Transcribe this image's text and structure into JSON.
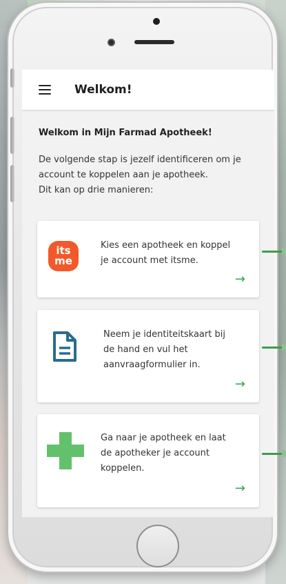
{
  "app": {
    "title": "Welkom!"
  },
  "intro": {
    "heading": "Welkom in Mijn Farmad Apotheek!",
    "lines": [
      "De volgende stap is jezelf identificeren om je",
      "account te koppelen aan je apotheek.",
      "Dit kan op drie manieren:"
    ]
  },
  "options": [
    {
      "icon": "itsme-logo-icon",
      "icon_text": [
        "its",
        "me"
      ],
      "lines": [
        "Kies een apotheek en koppel",
        "je account met itsme."
      ],
      "arrow": "→"
    },
    {
      "icon": "document-icon",
      "lines": [
        "Neem je identiteitskaart bij",
        "de hand en vul het",
        "aanvraagformulier in."
      ],
      "arrow": "→"
    },
    {
      "icon": "green-cross-icon",
      "lines": [
        "Ga naar je apotheek en laat",
        "de apotheker je account",
        "koppelen."
      ],
      "arrow": "→"
    }
  ],
  "colors": {
    "accent_green": "#2ea44f",
    "itsme_orange": "#f1592b",
    "doc_blue": "#2a6b8f",
    "cross_green": "#63c16b"
  }
}
